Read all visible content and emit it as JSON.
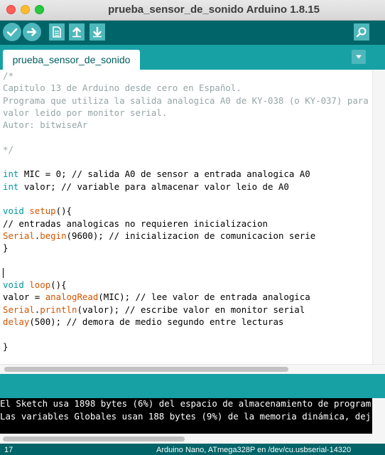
{
  "window": {
    "title": "prueba_sensor_de_sonido Arduino 1.8.15"
  },
  "toolbar": {
    "buttons": [
      {
        "name": "verify",
        "icon": "check-icon"
      },
      {
        "name": "upload",
        "icon": "arrow-right-icon"
      },
      {
        "name": "new",
        "icon": "document-icon"
      },
      {
        "name": "open",
        "icon": "arrow-up-icon"
      },
      {
        "name": "save",
        "icon": "arrow-down-icon"
      },
      {
        "name": "serial-monitor",
        "icon": "magnifier-icon"
      }
    ]
  },
  "tabs": [
    {
      "label": "prueba_sensor_de_sonido",
      "active": true
    }
  ],
  "code_lines": [
    [
      {
        "t": "/*",
        "c": "comment"
      }
    ],
    [
      {
        "t": "Capitulo 13 de Arduino desde cero en Español.",
        "c": "comment"
      }
    ],
    [
      {
        "t": "Programa que utiliza la salida analogica A0 de KY-038 (o KY-037) para",
        "c": "comment"
      }
    ],
    [
      {
        "t": "valor leido por monitor serial.",
        "c": "comment"
      }
    ],
    [
      {
        "t": "Autor: bitwiseAr",
        "c": "comment"
      }
    ],
    [],
    [
      {
        "t": "*/",
        "c": "comment"
      }
    ],
    [],
    [
      {
        "t": "int",
        "c": "type"
      },
      {
        "t": " MIC = 0; // salida A0 de sensor a entrada analogica A0",
        "c": "plain"
      }
    ],
    [
      {
        "t": "int",
        "c": "type"
      },
      {
        "t": " valor; // variable para almacenar valor leio de A0",
        "c": "plain"
      }
    ],
    [],
    [
      {
        "t": "void",
        "c": "type"
      },
      {
        "t": " ",
        "c": "plain"
      },
      {
        "t": "setup",
        "c": "func"
      },
      {
        "t": "(){",
        "c": "plain"
      }
    ],
    [
      {
        "t": "// entradas analogicas no requieren inicializacion",
        "c": "plain"
      }
    ],
    [
      {
        "t": "Serial",
        "c": "func"
      },
      {
        "t": ".",
        "c": "plain"
      },
      {
        "t": "begin",
        "c": "func"
      },
      {
        "t": "(9600); // inicializacion de comunicacion serie",
        "c": "plain"
      }
    ],
    [
      {
        "t": "}",
        "c": "plain"
      }
    ],
    [],
    [
      {
        "t": "",
        "c": "caret"
      }
    ],
    [
      {
        "t": "void",
        "c": "type"
      },
      {
        "t": " ",
        "c": "plain"
      },
      {
        "t": "loop",
        "c": "func"
      },
      {
        "t": "(){",
        "c": "plain"
      }
    ],
    [
      {
        "t": "valor = ",
        "c": "plain"
      },
      {
        "t": "analogRead",
        "c": "func"
      },
      {
        "t": "(MIC); // lee valor de entrada analogica",
        "c": "plain"
      }
    ],
    [
      {
        "t": "Serial",
        "c": "func"
      },
      {
        "t": ".",
        "c": "plain"
      },
      {
        "t": "println",
        "c": "func"
      },
      {
        "t": "(valor); // escribe valor en monitor serial",
        "c": "plain"
      }
    ],
    [
      {
        "t": "delay",
        "c": "func"
      },
      {
        "t": "(500); // demora de medio segundo entre lecturas",
        "c": "plain"
      }
    ],
    [],
    [
      {
        "t": "}",
        "c": "plain"
      }
    ]
  ],
  "console": {
    "lines": [
      "El Sketch usa 1898 bytes (6%) del espacio de almacenamiento de program",
      "Las variables Globales usan 188 bytes (9%) de la memoria dinámica, dej"
    ]
  },
  "status": {
    "line_number": "17",
    "board": "Arduino Nano, ATmega328P en /dev/cu.usbserial-14320"
  },
  "colors": {
    "toolbar_bg": "#006468",
    "tab_area_bg": "#17a1a5",
    "button_bg": "#4db7bb",
    "comment": "#95a5a6",
    "keyword_type": "#00979c",
    "function": "#d35400"
  }
}
